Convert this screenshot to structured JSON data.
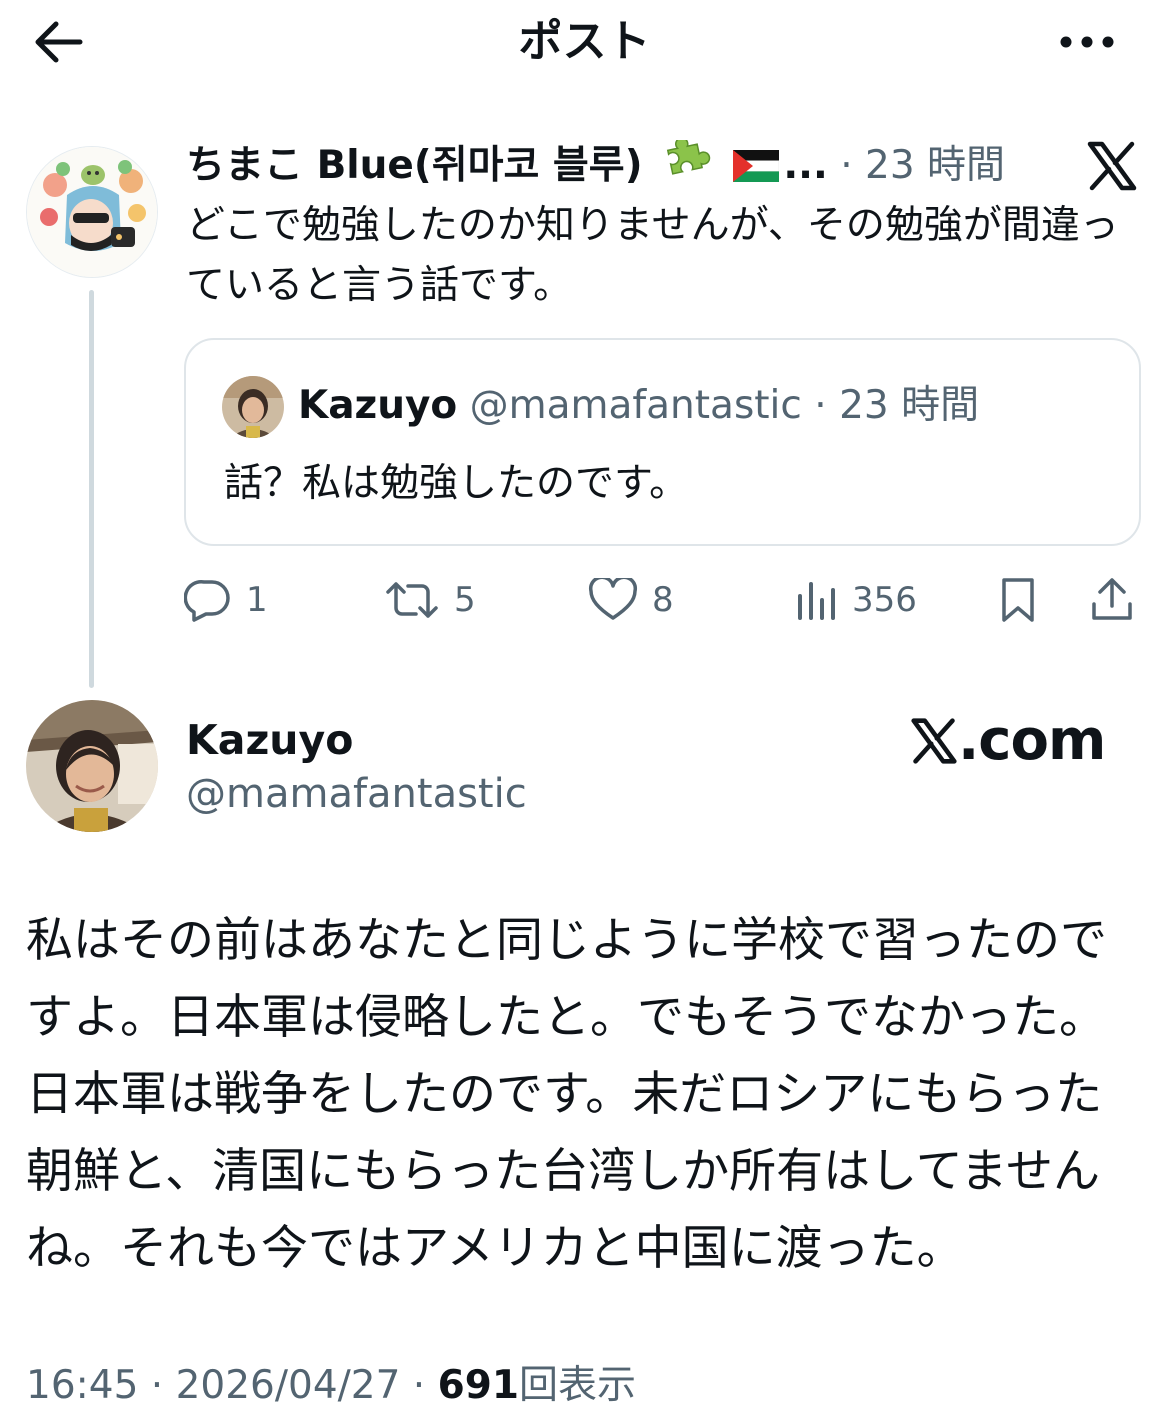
{
  "header": {
    "title": "ポスト",
    "back_icon": "arrow-left-icon",
    "more_icon": "more-horizontal-icon"
  },
  "parent_post": {
    "display_name": "ちまこ Blue(쥐마코 블루)",
    "emoji": [
      "puzzle-piece-emoji",
      "palestine-flag-emoji"
    ],
    "name_truncation": "...",
    "separator": "·",
    "time": "23 時間",
    "text": "どこで勉強したのか知りませんが、その勉強が間違っていると言う話です。",
    "badge_icon": "x-logo-icon",
    "quote": {
      "display_name": "Kazuyo",
      "handle": "@mamafantastic",
      "separator": "·",
      "time": "23 時間",
      "text": "話？私は勉強したのです。"
    },
    "actions": {
      "replies": "1",
      "reposts": "5",
      "likes": "8",
      "views": "356"
    }
  },
  "main_post": {
    "display_name": "Kazuyo",
    "handle": "@mamafantastic",
    "site_label": ".com",
    "text": "私はその前はあなたと同じように学校で習ったのですよ。日本軍は侵略したと。でもそうでなかった。日本軍は戦争をしたのです。未だロシアにもらった朝鮮と、清国にもらった台湾しか所有はしてませんね。それも今ではアメリカと中国に渡った。",
    "time": "16:45",
    "separator1": " · ",
    "date": "2026/04/27",
    "separator2": " · ",
    "view_count": "691",
    "view_label": "回表示"
  },
  "colors": {
    "text": "#0f1419",
    "secondary": "#536471",
    "border": "#dfe5e9",
    "thread_line": "#cfd9de",
    "flag_green": "#149954",
    "flag_red": "#e4312b",
    "puzzle_green": "#8bc34a"
  }
}
